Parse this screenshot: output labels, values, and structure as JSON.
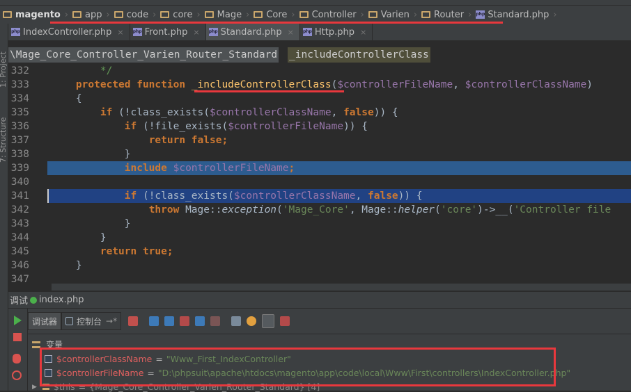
{
  "breadcrumb": [
    {
      "label": "magento",
      "icon": "folder-icon",
      "bold": true
    },
    {
      "label": "app",
      "icon": "folder-icon"
    },
    {
      "label": "code",
      "icon": "folder-icon"
    },
    {
      "label": "core",
      "icon": "folder-icon"
    },
    {
      "label": "Mage",
      "icon": "folder-icon"
    },
    {
      "label": "Core",
      "icon": "folder-icon"
    },
    {
      "label": "Controller",
      "icon": "folder-icon"
    },
    {
      "label": "Varien",
      "icon": "folder-icon"
    },
    {
      "label": "Router",
      "icon": "folder-icon"
    },
    {
      "label": "Standard.php",
      "icon": "php-file-icon"
    }
  ],
  "php_icon_text": "php",
  "tabs": [
    {
      "label": "IndexController.php",
      "active": false
    },
    {
      "label": "Front.php",
      "active": false
    },
    {
      "label": "Standard.php",
      "active": true
    },
    {
      "label": "Http.php",
      "active": false
    }
  ],
  "tab_close": "×",
  "side_tools": {
    "project": "1: Project",
    "structure": "7: Structure"
  },
  "path": {
    "class": "\\Mage_Core_Controller_Varien_Router_Standard",
    "method": "_includeControllerClass"
  },
  "code_lines": [
    {
      "n": "332",
      "tokens": [
        [
          "        ",
          "pl"
        ],
        [
          "*/",
          "cm"
        ]
      ]
    },
    {
      "n": "333",
      "tokens": [
        [
          "    ",
          "pl"
        ],
        [
          "protected function ",
          "kw"
        ],
        [
          "_includeControllerClass",
          "fn"
        ],
        [
          "(",
          "pl"
        ],
        [
          "$controllerFileName",
          "var"
        ],
        [
          ", ",
          "pl"
        ],
        [
          "$controllerClassName",
          "var"
        ],
        [
          ")",
          "pl"
        ]
      ]
    },
    {
      "n": "334",
      "tokens": [
        [
          "    {",
          "pl"
        ]
      ]
    },
    {
      "n": "335",
      "tokens": [
        [
          "        ",
          "pl"
        ],
        [
          "if ",
          "kw"
        ],
        [
          "(!class_exists(",
          "pl"
        ],
        [
          "$controllerClassName",
          "var"
        ],
        [
          ", ",
          "pl"
        ],
        [
          "false",
          "kw"
        ],
        [
          ")) {",
          "pl"
        ]
      ]
    },
    {
      "n": "336",
      "tokens": [
        [
          "            ",
          "pl"
        ],
        [
          "if ",
          "kw"
        ],
        [
          "(!file_exists(",
          "pl"
        ],
        [
          "$controllerFileName",
          "var"
        ],
        [
          ")) {",
          "pl"
        ]
      ]
    },
    {
      "n": "337",
      "tokens": [
        [
          "                ",
          "pl"
        ],
        [
          "return false",
          "kw"
        ],
        [
          ";",
          "kw"
        ]
      ]
    },
    {
      "n": "338",
      "tokens": [
        [
          "            }",
          "pl"
        ]
      ]
    },
    {
      "n": "339",
      "hl": "current",
      "tokens": [
        [
          "            ",
          "pl"
        ],
        [
          "include ",
          "kw"
        ],
        [
          "$controllerFileName",
          "var"
        ],
        [
          ";",
          "kw"
        ]
      ]
    },
    {
      "n": "340",
      "tokens": []
    },
    {
      "n": "341",
      "hl": "selected",
      "tokens": [
        [
          "            ",
          "pl"
        ],
        [
          "if ",
          "kw"
        ],
        [
          "(!class_exists(",
          "pl"
        ],
        [
          "$controllerClassName",
          "var"
        ],
        [
          ", ",
          "pl"
        ],
        [
          "false",
          "kw"
        ],
        [
          ")) {",
          "pl"
        ]
      ]
    },
    {
      "n": "342",
      "tokens": [
        [
          "                ",
          "pl"
        ],
        [
          "throw ",
          "kw"
        ],
        [
          "Mage::",
          "pl"
        ],
        [
          "exception",
          "it"
        ],
        [
          "(",
          "pl"
        ],
        [
          "'Mage_Core'",
          "str"
        ],
        [
          ", Mage::",
          "pl"
        ],
        [
          "helper",
          "it"
        ],
        [
          "(",
          "pl"
        ],
        [
          "'core'",
          "str"
        ],
        [
          ")->__(",
          "pl"
        ],
        [
          "'Controller file",
          "str"
        ]
      ]
    },
    {
      "n": "343",
      "tokens": [
        [
          "            }",
          "pl"
        ]
      ]
    },
    {
      "n": "344",
      "tokens": [
        [
          "        }",
          "pl"
        ]
      ]
    },
    {
      "n": "345",
      "tokens": [
        [
          "        ",
          "pl"
        ],
        [
          "return true",
          "kw"
        ],
        [
          ";",
          "kw"
        ]
      ]
    },
    {
      "n": "346",
      "tokens": [
        [
          "    }",
          "pl"
        ]
      ]
    },
    {
      "n": "347",
      "tokens": []
    }
  ],
  "debug": {
    "title": "调试",
    "file": "index.php",
    "tab_debugger": "调试器",
    "tab_console": "控制台",
    "console_arrow": "→*",
    "variables_label": "变量",
    "variables": [
      {
        "name": "$controllerClassName",
        "eq": "=",
        "value": "\"Www_First_IndexController\""
      },
      {
        "name": "$controllerFileName",
        "eq": "=",
        "value": "\"D:\\phpsuit\\apache\\htdocs\\magento\\app\\code\\local\\Www\\First\\controllers\\IndexController.php\""
      },
      {
        "name": "$this",
        "eq": "=",
        "value": "{Mage_Core_Controller_Varien_Router_Standard} [4]"
      }
    ]
  },
  "colors": {
    "annotation_red": "#e8383d",
    "current_line": "#2d5c8f",
    "selection": "#214283"
  }
}
